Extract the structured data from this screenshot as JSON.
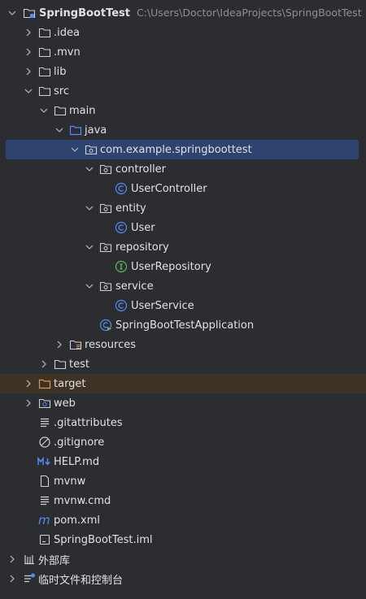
{
  "project": {
    "name": "SpringBootTest",
    "path": "C:\\Users\\Doctor\\IdeaProjects\\SpringBootTest"
  },
  "nodes": {
    "idea": ".idea",
    "mvn": ".mvn",
    "lib": "lib",
    "src": "src",
    "main": "main",
    "java": "java",
    "package": "com.example.springboottest",
    "controller": "controller",
    "user_controller": "UserController",
    "entity": "entity",
    "user": "User",
    "repository": "repository",
    "user_repository": "UserRepository",
    "service": "service",
    "user_service": "UserService",
    "application": "SpringBootTestApplication",
    "resources": "resources",
    "test": "test",
    "target": "target",
    "web": "web",
    "gitattributes": ".gitattributes",
    "gitignore": ".gitignore",
    "help": "HELP.md",
    "mvnw": "mvnw",
    "mvnw_cmd": "mvnw.cmd",
    "pom": "pom.xml",
    "iml": "SpringBootTest.iml",
    "external_libraries": "外部库",
    "scratches": "临时文件和控制台"
  },
  "colors": {
    "background": "#2b2d30",
    "selection": "#2e436e",
    "excluded": "#3d3223",
    "class_icon": "#548af7",
    "interface_icon": "#5fb865",
    "folder_icon": "#ced0d6",
    "source_folder_icon": "#548af7",
    "excluded_folder_icon": "#d5945e"
  }
}
